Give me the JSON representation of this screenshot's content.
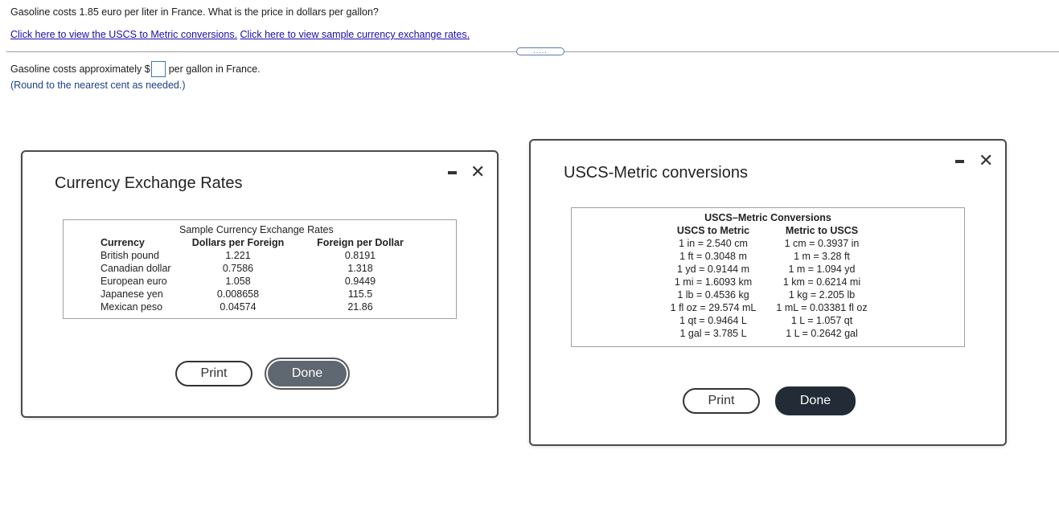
{
  "question": "Gasoline costs 1.85 euro per liter in France. What is the price in dollars per gallon?",
  "links": {
    "uscs": "Click here to view the USCS to Metric conversions.",
    "currency": "Click here to view sample currency exchange rates."
  },
  "expand_label": ".....",
  "answer": {
    "prefix": "Gasoline costs approximately $",
    "value": "",
    "suffix": "per gallon in France.",
    "hint": "(Round to the nearest cent as needed.)"
  },
  "currency_dialog": {
    "title": "Currency Exchange Rates",
    "caption": "Sample Currency Exchange Rates",
    "headers": [
      "Currency",
      "Dollars per Foreign",
      "Foreign per Dollar"
    ],
    "rows": [
      [
        "British pound",
        "1.221",
        "0.8191"
      ],
      [
        "Canadian dollar",
        "0.7586",
        "1.318"
      ],
      [
        "European euro",
        "1.058",
        "0.9449"
      ],
      [
        "Japanese yen",
        "0.008658",
        "115.5"
      ],
      [
        "Mexican peso",
        "0.04574",
        "21.86"
      ]
    ],
    "print_label": "Print",
    "done_label": "Done"
  },
  "uscs_dialog": {
    "title": "USCS-Metric conversions",
    "table_title": "USCS–Metric Conversions",
    "headers": [
      "USCS to Metric",
      "Metric to USCS"
    ],
    "rows": [
      [
        "1 in = 2.540 cm",
        "1 cm = 0.3937 in"
      ],
      [
        "1 ft = 0.3048 m",
        "1 m = 3.28 ft"
      ],
      [
        "1 yd = 0.9144 m",
        "1 m = 1.094 yd"
      ],
      [
        "1 mi = 1.6093 km",
        "1 km = 0.6214 mi"
      ],
      [
        "1 lb = 0.4536 kg",
        "1 kg = 2.205 lb"
      ],
      [
        "1 fl oz = 29.574 mL",
        "1 mL = 0.03381 fl oz"
      ],
      [
        "1 qt = 0.9464 L",
        "1 L = 1.057 qt"
      ],
      [
        "1 gal = 3.785 L",
        "1 L = 0.2642 gal"
      ]
    ],
    "print_label": "Print",
    "done_label": "Done"
  },
  "icons": {
    "minimize": "minimize-icon",
    "close": "close-icon"
  },
  "colors": {
    "link": "#1a0dab",
    "answer_box_border": "#3b78c2",
    "done_gray": "#5f6771",
    "done_dark": "#232b36"
  }
}
